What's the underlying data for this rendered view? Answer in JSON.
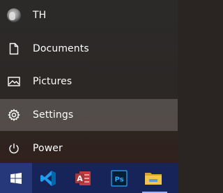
{
  "start_menu": {
    "user": {
      "label": "TH",
      "icon": "user-avatar"
    },
    "items": [
      {
        "label": "Documents",
        "icon": "document-icon"
      },
      {
        "label": "Pictures",
        "icon": "pictures-icon"
      },
      {
        "label": "Settings",
        "icon": "gear-icon",
        "highlighted": true
      },
      {
        "label": "Power",
        "icon": "power-icon"
      }
    ]
  },
  "taskbar": {
    "apps": [
      {
        "name": "start-button",
        "icon": "windows-logo-icon"
      },
      {
        "name": "visual-studio-code",
        "icon": "vscode-icon"
      },
      {
        "name": "microsoft-access",
        "icon": "access-icon",
        "letter": "A"
      },
      {
        "name": "photoshop",
        "icon": "photoshop-icon",
        "letter": "Ps"
      },
      {
        "name": "file-explorer",
        "icon": "folder-icon",
        "running": true
      }
    ]
  },
  "colors": {
    "panel_bg": "#2b2a29",
    "highlight": "#5b5756",
    "taskbar_bg": "#17245a",
    "access_red": "#a4373a",
    "ps_blue": "#31a8ff",
    "ps_bg": "#001e36",
    "vscode_blue": "#0065a9",
    "folder_yellow": "#f3c64a"
  }
}
